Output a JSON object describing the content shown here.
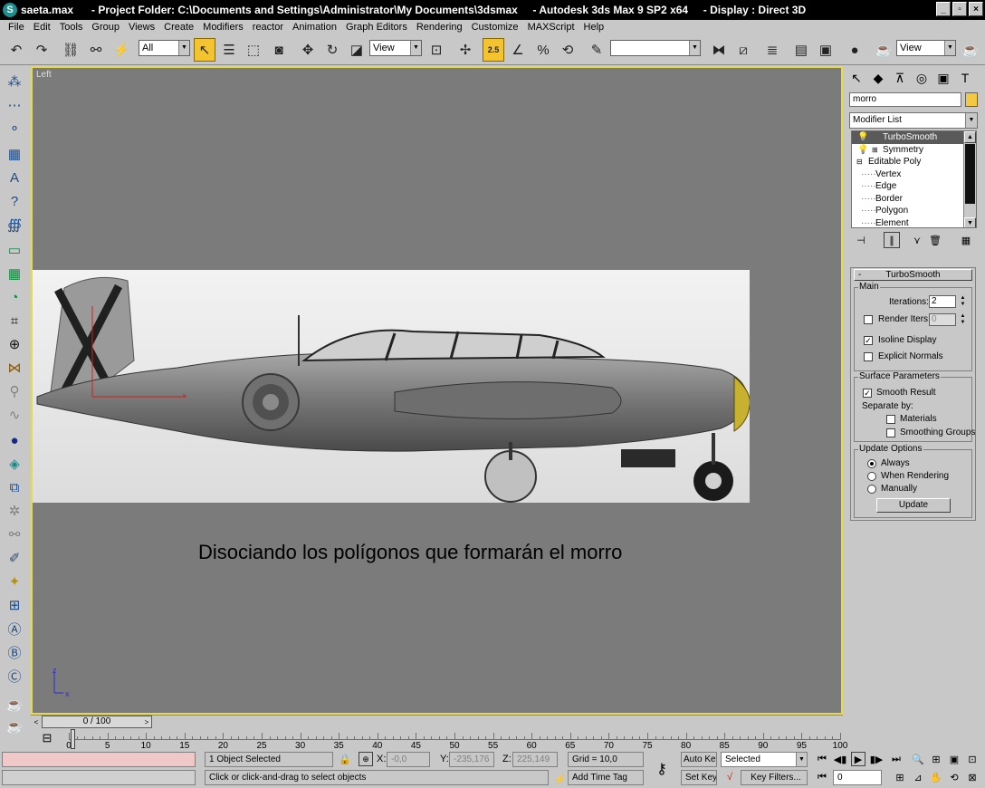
{
  "window": {
    "title": "saeta.max      - Project Folder: C:\\Documents and Settings\\Administrator\\My Documents\\3dsmax     - Autodesk 3ds Max 9 SP2 x64     - Display : Direct 3D",
    "controls": [
      "_",
      "▫",
      "×"
    ]
  },
  "menu": [
    "File",
    "Edit",
    "Tools",
    "Group",
    "Views",
    "Create",
    "Modifiers",
    "reactor",
    "Animation",
    "Graph Editors",
    "Rendering",
    "Customize",
    "MAXScript",
    "Help"
  ],
  "toolbar": {
    "selection_filter": "All",
    "reference_coord": "View",
    "snap_label": "2.5",
    "named_selection": "",
    "render_view": "View"
  },
  "viewport": {
    "label": "Left",
    "caption": "Disociando los polígonos que formarán el morro",
    "axis_z": "z",
    "axis_x": "x"
  },
  "command_panel": {
    "object_name": "morro",
    "object_color": "#f5c842",
    "modifier_list": "Modifier List",
    "stack": [
      {
        "label": "TurboSmooth",
        "selected": true,
        "indent": 1
      },
      {
        "label": "Symmetry",
        "selected": false,
        "indent": 1
      },
      {
        "label": "Editable Poly",
        "selected": false,
        "indent": 0
      },
      {
        "label": "Vertex",
        "selected": false,
        "indent": 2
      },
      {
        "label": "Edge",
        "selected": false,
        "indent": 2
      },
      {
        "label": "Border",
        "selected": false,
        "indent": 2
      },
      {
        "label": "Polygon",
        "selected": false,
        "indent": 2
      },
      {
        "label": "Element",
        "selected": false,
        "indent": 2
      }
    ],
    "turbosmooth": {
      "title": "TurboSmooth",
      "collapse": "-",
      "main_group": "Main",
      "iterations_label": "Iterations:",
      "iterations_value": "2",
      "render_iters_label": "Render Iters:",
      "render_iters_value": "0",
      "render_iters_checked": false,
      "isoline_label": "Isoline Display",
      "isoline_checked": true,
      "explicit_normals_label": "Explicit Normals",
      "explicit_normals_checked": false,
      "surface_group": "Surface Parameters",
      "smooth_result_label": "Smooth Result",
      "smooth_result_checked": true,
      "separate_by_label": "Separate by:",
      "materials_label": "Materials",
      "materials_checked": false,
      "smoothing_groups_label": "Smoothing Groups",
      "smoothing_groups_checked": false,
      "update_group": "Update Options",
      "always_label": "Always",
      "when_rendering_label": "When Rendering",
      "manually_label": "Manually",
      "update_mode": "Always",
      "update_button": "Update"
    }
  },
  "timeline": {
    "frame_display": "0 / 100",
    "prev": "<",
    "next": ">",
    "ticks": [
      "0",
      "5",
      "10",
      "15",
      "20",
      "25",
      "30",
      "35",
      "40",
      "45",
      "50",
      "55",
      "60",
      "65",
      "70",
      "75",
      "80",
      "85",
      "90",
      "95",
      "100"
    ]
  },
  "status": {
    "selection_count": "1 Object Selected",
    "prompt": "Click or click-and-drag to select objects",
    "x_label": "X:",
    "x_value": "-0,0",
    "y_label": "Y:",
    "y_value": "-235,176",
    "z_label": "Z:",
    "z_value": "225,149",
    "grid": "Grid = 10,0",
    "add_time_tag": "Add Time Tag",
    "auto_key": "Auto Key",
    "set_key": "Set Key",
    "key_mode": "Selected",
    "key_filters": "Key Filters...",
    "current_frame": "0"
  }
}
